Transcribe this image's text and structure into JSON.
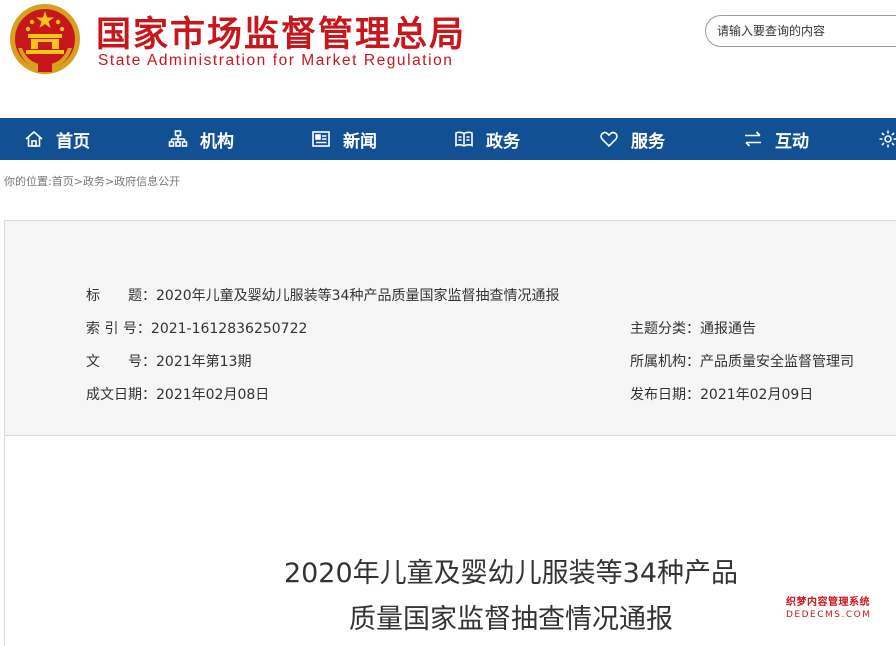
{
  "header": {
    "title": "国家市场监督管理总局",
    "subtitle": "State Administration for Market Regulation",
    "search_placeholder": "请输入要查询的内容"
  },
  "nav": {
    "items": [
      {
        "label": "首页",
        "icon": "home-icon"
      },
      {
        "label": "机构",
        "icon": "org-icon"
      },
      {
        "label": "新闻",
        "icon": "news-icon"
      },
      {
        "label": "政务",
        "icon": "government-affairs-icon"
      },
      {
        "label": "服务",
        "icon": "heart-icon"
      },
      {
        "label": "互动",
        "icon": "exchange-icon"
      }
    ]
  },
  "breadcrumb": {
    "prefix": "你的位置:",
    "items": [
      "首页",
      "政务",
      "政府信息公开"
    ],
    "separator": ">"
  },
  "info": {
    "title_key": "标　　题：",
    "title_value": "2020年儿童及婴幼儿服装等34种产品质量国家监督抽查情况通报",
    "index_key": "索 引 号：",
    "index_value": "2021-1612836250722",
    "docno_key": "文　　号：",
    "docno_value": "2021年第13期",
    "created_key": "成文日期：",
    "created_value": "2021年02月08日",
    "topic_key": "主题分类：",
    "topic_value": "通报通告",
    "agency_key": "所属机构：",
    "agency_value": "产品质量安全监督管理司",
    "published_key": "发布日期：",
    "published_value": "2021年02月09日"
  },
  "document": {
    "heading_line1": "2020年儿童及婴幼儿服装等34种产品",
    "heading_line2": "质量国家监督抽查情况通报"
  },
  "watermark": {
    "line1": "织梦内容管理系统",
    "line2": "DEDECMS.COM"
  },
  "colors": {
    "brand_red": "#c8161d",
    "nav_blue": "#125094"
  }
}
